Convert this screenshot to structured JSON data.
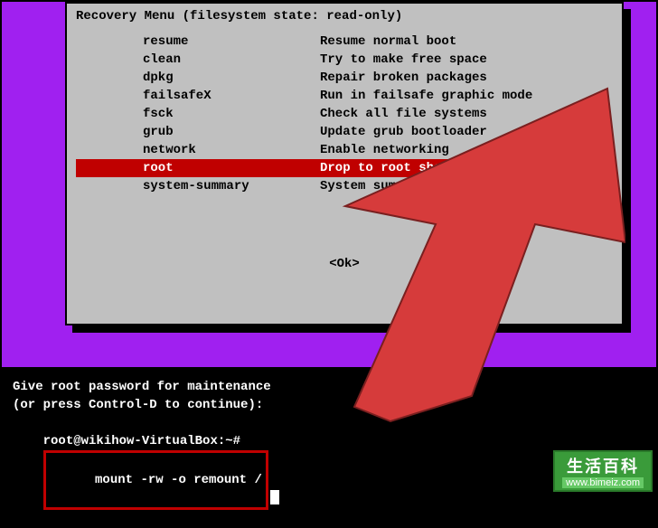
{
  "menu": {
    "title": "Recovery Menu (filesystem state: read-only)",
    "items": [
      {
        "key": "resume",
        "desc": "Resume normal boot"
      },
      {
        "key": "clean",
        "desc": "Try to make free space"
      },
      {
        "key": "dpkg",
        "desc": "Repair broken packages"
      },
      {
        "key": "failsafeX",
        "desc": "Run in failsafe graphic mode"
      },
      {
        "key": "fsck",
        "desc": "Check all file systems"
      },
      {
        "key": "grub",
        "desc": "Update grub bootloader"
      },
      {
        "key": "network",
        "desc": "Enable networking"
      },
      {
        "key": "root",
        "desc": "Drop to root shell prompt"
      },
      {
        "key": "system-summary",
        "desc": "System summary"
      }
    ],
    "selected_index": 7,
    "ok_label": "<Ok>"
  },
  "terminal": {
    "line1": "Give root password for maintenance",
    "line2": "(or press Control-D to continue):",
    "prompt": "root@wikihow-VirtualBox:~#",
    "command": "mount -rw -o remount /"
  },
  "watermark": {
    "title": "生活百科",
    "url": "www.bimeiz.com"
  },
  "colors": {
    "purple": "#a020f0",
    "gray": "#c0c0c0",
    "red": "#c00000",
    "arrow": "#d63b3b"
  }
}
